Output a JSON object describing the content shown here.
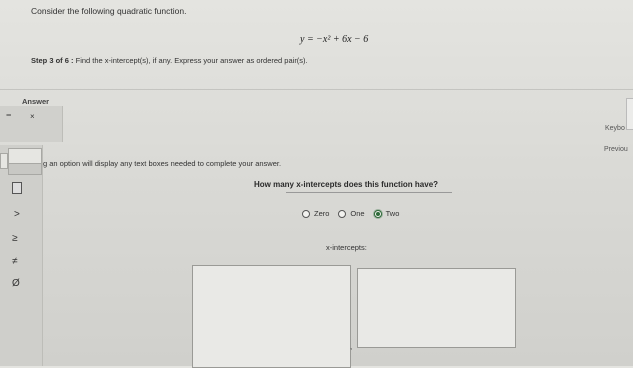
{
  "problem": {
    "prompt": "Consider the following quadratic function.",
    "equation": "y = −x² + 6x − 6"
  },
  "step": {
    "label": "Step 3 of 6 :",
    "text": "Find the x-intercept(s), if any. Express your answer as ordered pair(s)."
  },
  "answer": {
    "label": "Answer",
    "minus": "−",
    "close": "×",
    "keyboard": "Keybo",
    "previous": "Previou",
    "instruction": "g an option will display any text boxes needed to complete your answer.",
    "question": "How many x-intercepts does this function have?",
    "options": [
      {
        "label": "Zero",
        "selected": false
      },
      {
        "label": "One",
        "selected": false
      },
      {
        "label": "Two",
        "selected": true
      }
    ],
    "xintercepts_label": "x-intercepts:",
    "separator": ","
  },
  "symbols": {
    "gt": ">",
    "ge": "≥",
    "ne": "≠",
    "empty": "Ø"
  },
  "colors": {
    "selected_radio": "#2f6b3a"
  }
}
